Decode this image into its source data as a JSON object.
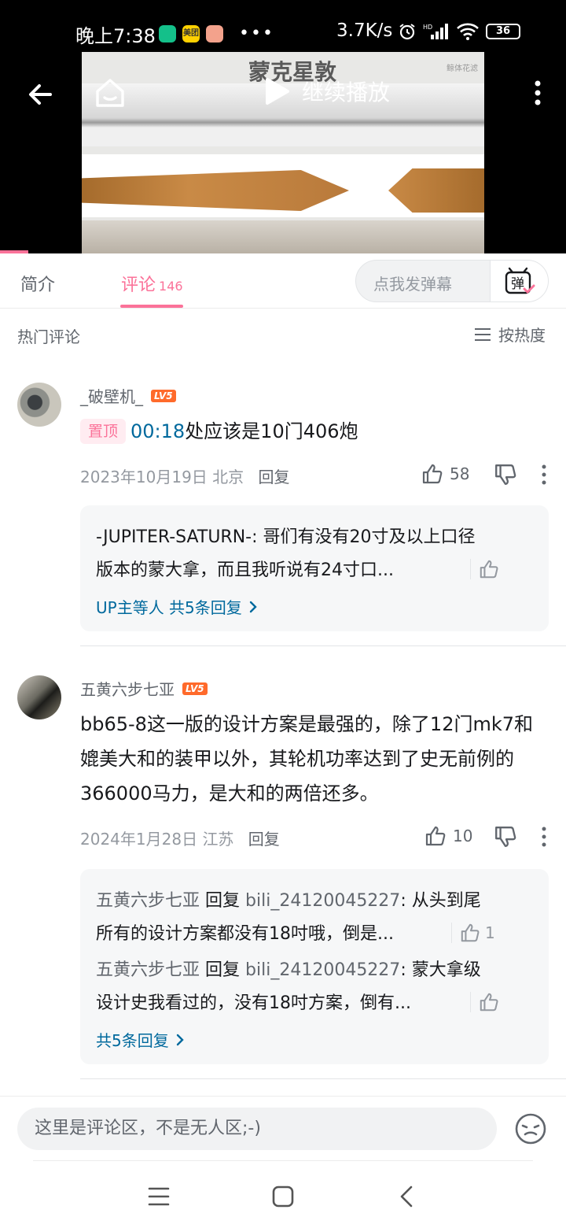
{
  "status_bar": {
    "time": "晚上7:38",
    "speed": "3.7K/s",
    "battery": "36",
    "app_icon_1": "美团",
    "hd_label": "HD"
  },
  "video": {
    "thumbnail_title": "蒙克星敦",
    "watermark": "鲸体花滤",
    "play_label": "继续播放",
    "progress_percent": 5
  },
  "tabs": {
    "intro": "简介",
    "comments": "评论",
    "comments_count": "146",
    "danmaku_placeholder": "点我发弹幕",
    "danmaku_icon_char": "弹"
  },
  "section": {
    "title": "热门评论",
    "sort_label": "按热度"
  },
  "comments": [
    {
      "username": "_破壁机_",
      "level": "LV5",
      "pinned_label": "置顶",
      "timestamp": "00:18",
      "text": "处应该是10门406炮",
      "date": "2023年10月19日",
      "location": "北京",
      "reply_label": "回复",
      "likes": "58",
      "replies": [
        {
          "text": "-JUPITER-SATURN-: 哥们有没有20寸及以上口径版本的蒙大拿，而且我听说有24寸口...",
          "likes": ""
        }
      ],
      "more_replies": "UP主等人 共5条回复"
    },
    {
      "username": "五黄六步七亚",
      "level": "LV5",
      "text": "bb65-8这一版的设计方案是最强的，除了12门mk7和媲美大和的装甲以外，其轮机功率达到了史无前例的366000马力，是大和的两倍还多。",
      "date": "2024年1月28日",
      "location": "江苏",
      "reply_label": "回复",
      "likes": "10",
      "replies": [
        {
          "name": "五黄六步七亚",
          "verb": "回复",
          "target": "bili_24120045227",
          "text": ": 从头到尾所有的设计方案都没有18吋哦，倒是...",
          "likes": "1"
        },
        {
          "name": "五黄六步七亚",
          "verb": "回复",
          "target": "bili_24120045227",
          "text": ": 蒙大拿级设计史我看过的，没有18吋方案，倒有...",
          "likes": ""
        }
      ],
      "more_replies": "共5条回复"
    }
  ],
  "bottom": {
    "input_placeholder": "这里是评论区，不是无人区;-)"
  },
  "colors": {
    "accent": "#fb7299",
    "link": "#00699d",
    "level_badge": "#ff6a2b"
  },
  "icons": [
    "back-arrow-icon",
    "home-icon",
    "play-icon",
    "more-vertical-icon",
    "danmaku-icon",
    "sort-lines-icon",
    "thumb-up-icon",
    "thumb-down-icon",
    "chevron-right-icon",
    "emoji-icon",
    "menu-icon",
    "square-icon",
    "chevron-left-icon"
  ]
}
